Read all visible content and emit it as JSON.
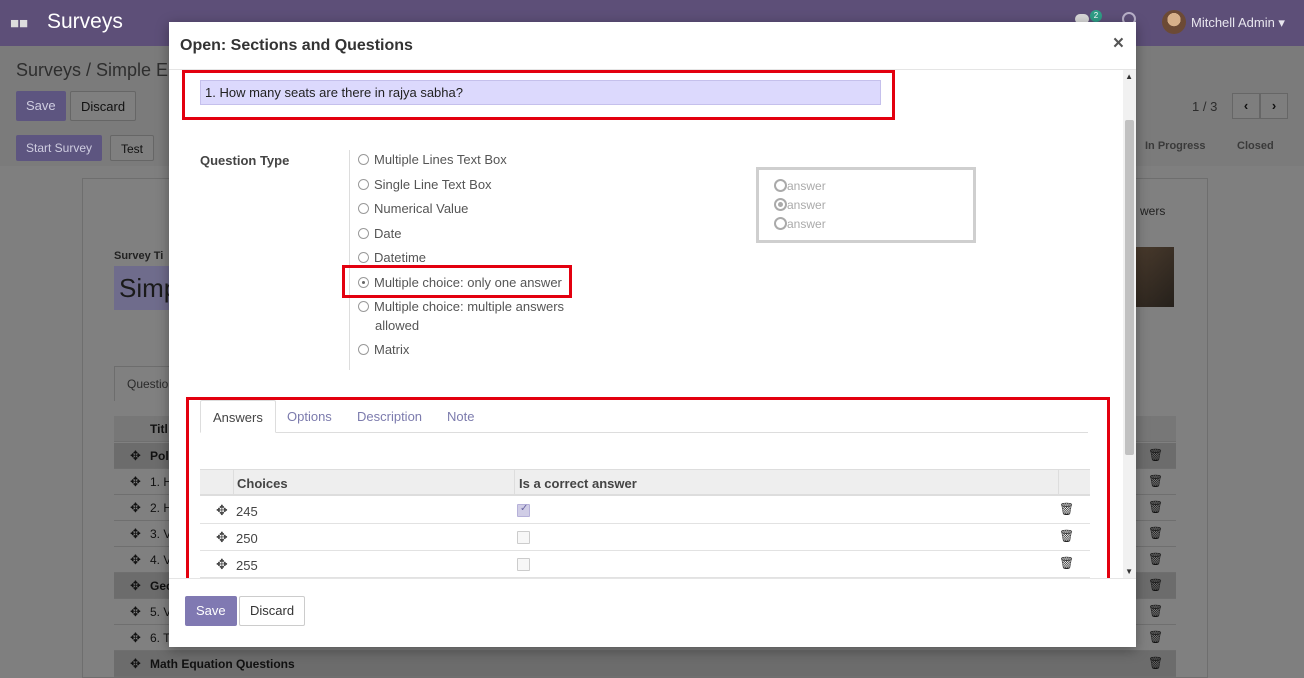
{
  "app": {
    "brand": "Surveys",
    "user": "Mitchell Admin",
    "notification_count": "2",
    "breadcrumb": "Surveys / Simple E",
    "save_label": "Save",
    "discard_label": "Discard",
    "start_survey_label": "Start Survey",
    "test_label": "Test",
    "pager": "1 / 3",
    "statuses": [
      "In Progress",
      "Closed"
    ],
    "survey_title_label": "Survey Ti",
    "survey_title_value": "Simp",
    "tab_questions": "Questio",
    "answers_fragment": "wers",
    "table_title_header": "Titl",
    "rows": [
      "Pol",
      "1. H",
      "2. H",
      "3. V",
      "4. V",
      "Geo",
      "5. V",
      "6. T",
      "Math Equation Questions"
    ]
  },
  "modal": {
    "title": "Open: Sections and Questions",
    "close": "×",
    "question": "1. How many seats are there in rajya sabha?",
    "question_type_label": "Question Type",
    "question_types": [
      {
        "label": "Multiple Lines Text Box",
        "checked": false
      },
      {
        "label": "Single Line Text Box",
        "checked": false
      },
      {
        "label": "Numerical Value",
        "checked": false
      },
      {
        "label": "Date",
        "checked": false
      },
      {
        "label": "Datetime",
        "checked": false
      },
      {
        "label": "Multiple choice: only one answer",
        "checked": true
      },
      {
        "label": "Multiple choice: multiple answers",
        "label2": "allowed",
        "checked": false
      },
      {
        "label": "Matrix",
        "checked": false
      }
    ],
    "preview_options": [
      "answer",
      "answer",
      "answer"
    ],
    "tabs": [
      {
        "label": "Answers",
        "active": true
      },
      {
        "label": "Options",
        "active": false
      },
      {
        "label": "Description",
        "active": false
      },
      {
        "label": "Note",
        "active": false
      }
    ],
    "columns": {
      "choices": "Choices",
      "correct": "Is a correct answer"
    },
    "answers": [
      {
        "value": "245",
        "correct": true
      },
      {
        "value": "250",
        "correct": false
      },
      {
        "value": "255",
        "correct": false
      }
    ],
    "footer": {
      "save": "Save",
      "discard": "Discard"
    }
  }
}
